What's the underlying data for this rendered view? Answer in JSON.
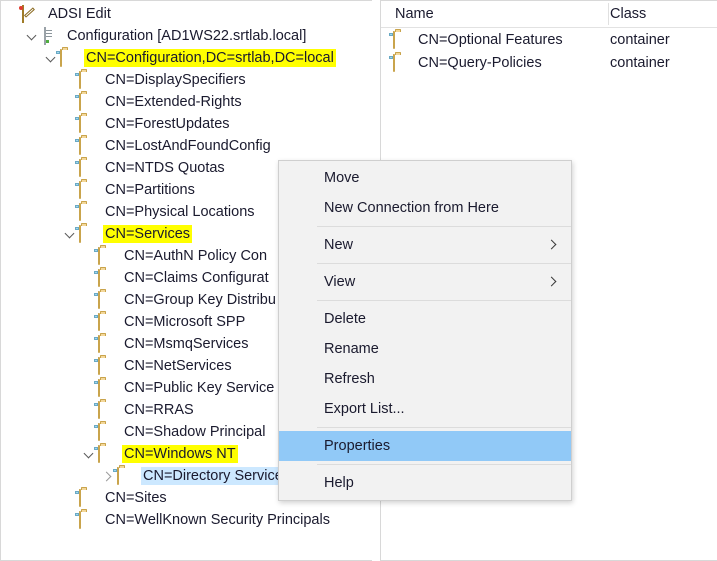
{
  "colors": {
    "highlight_yellow": "#ffff00",
    "selection_blue": "#cce8ff",
    "menu_selected_blue": "#91c9f7",
    "menu_background": "#f2f2f2"
  },
  "tree": {
    "root": {
      "label": "ADSI Edit",
      "icon": "adsi-edit-icon"
    },
    "items": [
      {
        "label": "ADSI Edit",
        "depth": 0,
        "icon": "adsi-edit-icon",
        "twisty": "none",
        "highlight": false,
        "selected": false
      },
      {
        "label": "Configuration [AD1WS22.srtlab.local]",
        "depth": 1,
        "icon": "server-icon",
        "twisty": "expanded",
        "highlight": false,
        "selected": false
      },
      {
        "label": "CN=Configuration,DC=srtlab,DC=local",
        "depth": 2,
        "icon": "folder-icon",
        "twisty": "expanded",
        "highlight": true,
        "selected": false
      },
      {
        "label": "CN=DisplaySpecifiers",
        "depth": 3,
        "icon": "folder-icon",
        "twisty": "none",
        "highlight": false,
        "selected": false
      },
      {
        "label": "CN=Extended-Rights",
        "depth": 3,
        "icon": "folder-icon",
        "twisty": "none",
        "highlight": false,
        "selected": false
      },
      {
        "label": "CN=ForestUpdates",
        "depth": 3,
        "icon": "folder-icon",
        "twisty": "none",
        "highlight": false,
        "selected": false
      },
      {
        "label": "CN=LostAndFoundConfig",
        "depth": 3,
        "icon": "folder-icon",
        "twisty": "none",
        "highlight": false,
        "selected": false
      },
      {
        "label": "CN=NTDS Quotas",
        "depth": 3,
        "icon": "folder-icon",
        "twisty": "none",
        "highlight": false,
        "selected": false
      },
      {
        "label": "CN=Partitions",
        "depth": 3,
        "icon": "folder-icon",
        "twisty": "none",
        "highlight": false,
        "selected": false
      },
      {
        "label": "CN=Physical Locations",
        "depth": 3,
        "icon": "folder-icon",
        "twisty": "none",
        "highlight": false,
        "selected": false
      },
      {
        "label": "CN=Services",
        "depth": 3,
        "icon": "folder-icon",
        "twisty": "expanded",
        "highlight": true,
        "selected": false
      },
      {
        "label": "CN=AuthN Policy Con",
        "depth": 4,
        "icon": "folder-icon",
        "twisty": "none",
        "highlight": false,
        "selected": false
      },
      {
        "label": "CN=Claims Configurat",
        "depth": 4,
        "icon": "folder-icon",
        "twisty": "none",
        "highlight": false,
        "selected": false
      },
      {
        "label": "CN=Group Key Distribu",
        "depth": 4,
        "icon": "folder-icon",
        "twisty": "none",
        "highlight": false,
        "selected": false
      },
      {
        "label": "CN=Microsoft SPP",
        "depth": 4,
        "icon": "folder-icon",
        "twisty": "none",
        "highlight": false,
        "selected": false
      },
      {
        "label": "CN=MsmqServices",
        "depth": 4,
        "icon": "folder-icon",
        "twisty": "none",
        "highlight": false,
        "selected": false
      },
      {
        "label": "CN=NetServices",
        "depth": 4,
        "icon": "folder-icon",
        "twisty": "none",
        "highlight": false,
        "selected": false
      },
      {
        "label": "CN=Public Key Service",
        "depth": 4,
        "icon": "folder-icon",
        "twisty": "none",
        "highlight": false,
        "selected": false
      },
      {
        "label": "CN=RRAS",
        "depth": 4,
        "icon": "folder-icon",
        "twisty": "none",
        "highlight": false,
        "selected": false
      },
      {
        "label": "CN=Shadow Principal",
        "depth": 4,
        "icon": "folder-icon",
        "twisty": "none",
        "highlight": false,
        "selected": false
      },
      {
        "label": "CN=Windows NT",
        "depth": 4,
        "icon": "folder-icon",
        "twisty": "expanded",
        "highlight": true,
        "selected": false
      },
      {
        "label": "CN=Directory Service",
        "depth": 5,
        "icon": "folder-icon",
        "twisty": "collapsed",
        "highlight": false,
        "selected": true
      },
      {
        "label": "CN=Sites",
        "depth": 3,
        "icon": "folder-icon",
        "twisty": "none",
        "highlight": false,
        "selected": false
      },
      {
        "label": "CN=WellKnown Security Principals",
        "depth": 3,
        "icon": "folder-icon",
        "twisty": "none",
        "highlight": false,
        "selected": false
      }
    ]
  },
  "list_view": {
    "columns": [
      "Name",
      "Class"
    ],
    "rows": [
      {
        "name": "CN=Optional Features",
        "class": "container",
        "icon": "folder-icon"
      },
      {
        "name": "CN=Query-Policies",
        "class": "container",
        "icon": "folder-icon"
      }
    ]
  },
  "context_menu": {
    "items": [
      {
        "label": "Move",
        "type": "item",
        "submenu": false,
        "selected": false
      },
      {
        "label": "New Connection from Here",
        "type": "item",
        "submenu": false,
        "selected": false
      },
      {
        "label": "",
        "type": "separator",
        "submenu": false,
        "selected": false
      },
      {
        "label": "New",
        "type": "item",
        "submenu": true,
        "selected": false
      },
      {
        "label": "",
        "type": "separator",
        "submenu": false,
        "selected": false
      },
      {
        "label": "View",
        "type": "item",
        "submenu": true,
        "selected": false
      },
      {
        "label": "",
        "type": "separator",
        "submenu": false,
        "selected": false
      },
      {
        "label": "Delete",
        "type": "item",
        "submenu": false,
        "selected": false
      },
      {
        "label": "Rename",
        "type": "item",
        "submenu": false,
        "selected": false
      },
      {
        "label": "Refresh",
        "type": "item",
        "submenu": false,
        "selected": false
      },
      {
        "label": "Export List...",
        "type": "item",
        "submenu": false,
        "selected": false
      },
      {
        "label": "",
        "type": "separator",
        "submenu": false,
        "selected": false
      },
      {
        "label": "Properties",
        "type": "item",
        "submenu": false,
        "selected": true
      },
      {
        "label": "",
        "type": "separator",
        "submenu": false,
        "selected": false
      },
      {
        "label": "Help",
        "type": "item",
        "submenu": false,
        "selected": false
      }
    ]
  }
}
